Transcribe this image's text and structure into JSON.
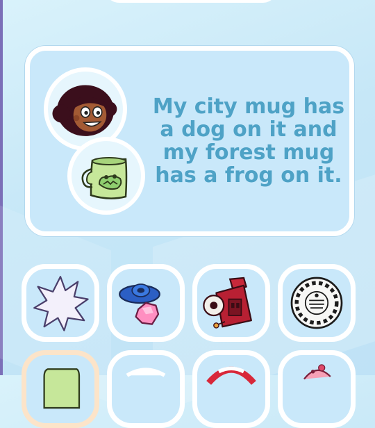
{
  "dialog": {
    "text": "My city mug has a dog on it and my forest mug has a frog on it.",
    "speaker_icon": "connie-portrait-icon",
    "item_icon": "frog-mug-icon"
  },
  "inventory": {
    "row1": [
      {
        "icon": "star-burst-icon"
      },
      {
        "icon": "gem-ring-icon"
      },
      {
        "icon": "red-camera-icon"
      },
      {
        "icon": "viewmaster-reel-icon"
      }
    ],
    "row2": [
      {
        "icon": "green-mug-icon"
      },
      {
        "icon": "blank-item-icon"
      },
      {
        "icon": "life-ring-icon"
      },
      {
        "icon": "pink-creature-icon"
      }
    ]
  },
  "colors": {
    "dialog_text": "#4ea2c6",
    "dialog_bg": "#c9e8fa",
    "top_bar": "#c7b6ee"
  }
}
